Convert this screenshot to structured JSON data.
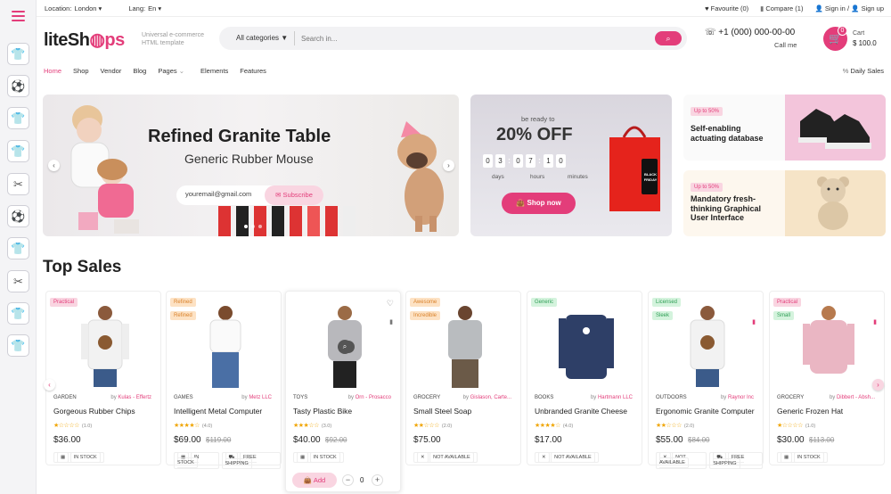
{
  "topbar": {
    "location_label": "Location:",
    "location": "London",
    "lang_label": "Lang:",
    "lang": "En",
    "favourite": "Favourite (0)",
    "compare": "Compare (1)",
    "sign_in": "Sign in",
    "slash": "/",
    "sign_up": "Sign up"
  },
  "header": {
    "logo_a": "liteSh",
    "logo_b": "ps",
    "tagline_1": "Universal e-commerce",
    "tagline_2": "HTML template",
    "category": "All categories",
    "search_placeholder": "Search in...",
    "phone": "+1 (000) 000-00-00",
    "call_me": "Call me",
    "cart_count": "0",
    "cart_label": "Cart",
    "cart_sum": "$ 100.0"
  },
  "nav": {
    "items": [
      "Home",
      "Shop",
      "Vendor",
      "Blog",
      "Pages",
      "Elements",
      "Features"
    ],
    "daily": "Daily Sales"
  },
  "hero": {
    "title": "Refined Granite Table",
    "subtitle": "Generic Rubber Mouse",
    "email_value": "youremail@gmail.com",
    "subscribe": "Subscribe"
  },
  "promo": {
    "ready": "be ready to",
    "discount": "20% OFF",
    "digits": [
      "0",
      "3",
      "0",
      "7",
      "1",
      "0"
    ],
    "days": "days",
    "hours": "hours",
    "minutes": "minutes",
    "button": "Shop now",
    "bag_text_1": "BLACK",
    "bag_text_2": "FRIDAY"
  },
  "cards": [
    {
      "label": "Up to 50%",
      "title_1": "Self-enabling",
      "title_2": "actuating database"
    },
    {
      "label": "Up to 50%",
      "title_1": "Mandatory fresh-",
      "title_2": "thinking Graphical",
      "title_3": "User Interface"
    }
  ],
  "section_title": "Top Sales",
  "products": [
    {
      "labels": [
        "Practical"
      ],
      "category": "GARDEN",
      "by": "by",
      "vendor": "Kulas - Effertz",
      "name": "Gorgeous Rubber Chips",
      "rating": 1,
      "rating_text": "(1.0)",
      "price": "$36.00",
      "old_price": "",
      "tags": [
        "IN STOCK"
      ]
    },
    {
      "labels": [
        "Refined",
        "Refined"
      ],
      "category": "GAMES",
      "by": "by",
      "vendor": "Metz LLC",
      "name": "Intelligent Metal Computer",
      "rating": 4,
      "rating_text": "(4.0)",
      "price": "$69.00",
      "old_price": "$119.00",
      "tags": [
        "IN STOCK",
        "FREE SHIPPING"
      ]
    },
    {
      "labels": [],
      "category": "TOYS",
      "by": "by",
      "vendor": "Orn - Prosacco",
      "name": "Tasty Plastic Bike",
      "rating": 3,
      "rating_text": "(3.0)",
      "price": "$40.00",
      "old_price": "$92.00",
      "tags": [
        "IN STOCK"
      ],
      "add": "Add",
      "qty": "0"
    },
    {
      "labels": [
        "Awesome",
        "Incredible"
      ],
      "category": "GROCERY",
      "by": "by",
      "vendor": "Gislason, Carte...",
      "name": "Small Steel Soap",
      "rating": 2,
      "rating_text": "(2.0)",
      "price": "$75.00",
      "old_price": "",
      "tags": [
        "NOT AVAILABLE"
      ]
    },
    {
      "labels": [
        "Generic"
      ],
      "category": "BOOKS",
      "by": "by",
      "vendor": "Hartmann LLC",
      "name": "Unbranded Granite Cheese",
      "rating": 4,
      "rating_text": "(4.0)",
      "price": "$17.00",
      "old_price": "",
      "tags": [
        "NOT AVAILABLE"
      ]
    },
    {
      "labels": [
        "Licensed",
        "Sleek"
      ],
      "category": "OUTDOORS",
      "by": "by",
      "vendor": "Raynor Inc",
      "name": "Ergonomic Granite Computer",
      "rating": 2,
      "rating_text": "(2.0)",
      "price": "$55.00",
      "old_price": "$84.00",
      "tags": [
        "NOT AVAILABLE",
        "FREE SHIPPING"
      ]
    },
    {
      "labels": [
        "Practical",
        "Small"
      ],
      "category": "GROCERY",
      "by": "by",
      "vendor": "Dibbert - Absh...",
      "name": "Generic Frozen Hat",
      "rating": 1,
      "rating_text": "(1.0)",
      "price": "$30.00",
      "old_price": "$113.00",
      "tags": [
        "IN STOCK"
      ]
    }
  ],
  "colors": {
    "accent": "#e33d7a",
    "label_pink": "#f9d5e1",
    "label_orange": "#fde2c4",
    "label_green": "#d4f3dd"
  }
}
